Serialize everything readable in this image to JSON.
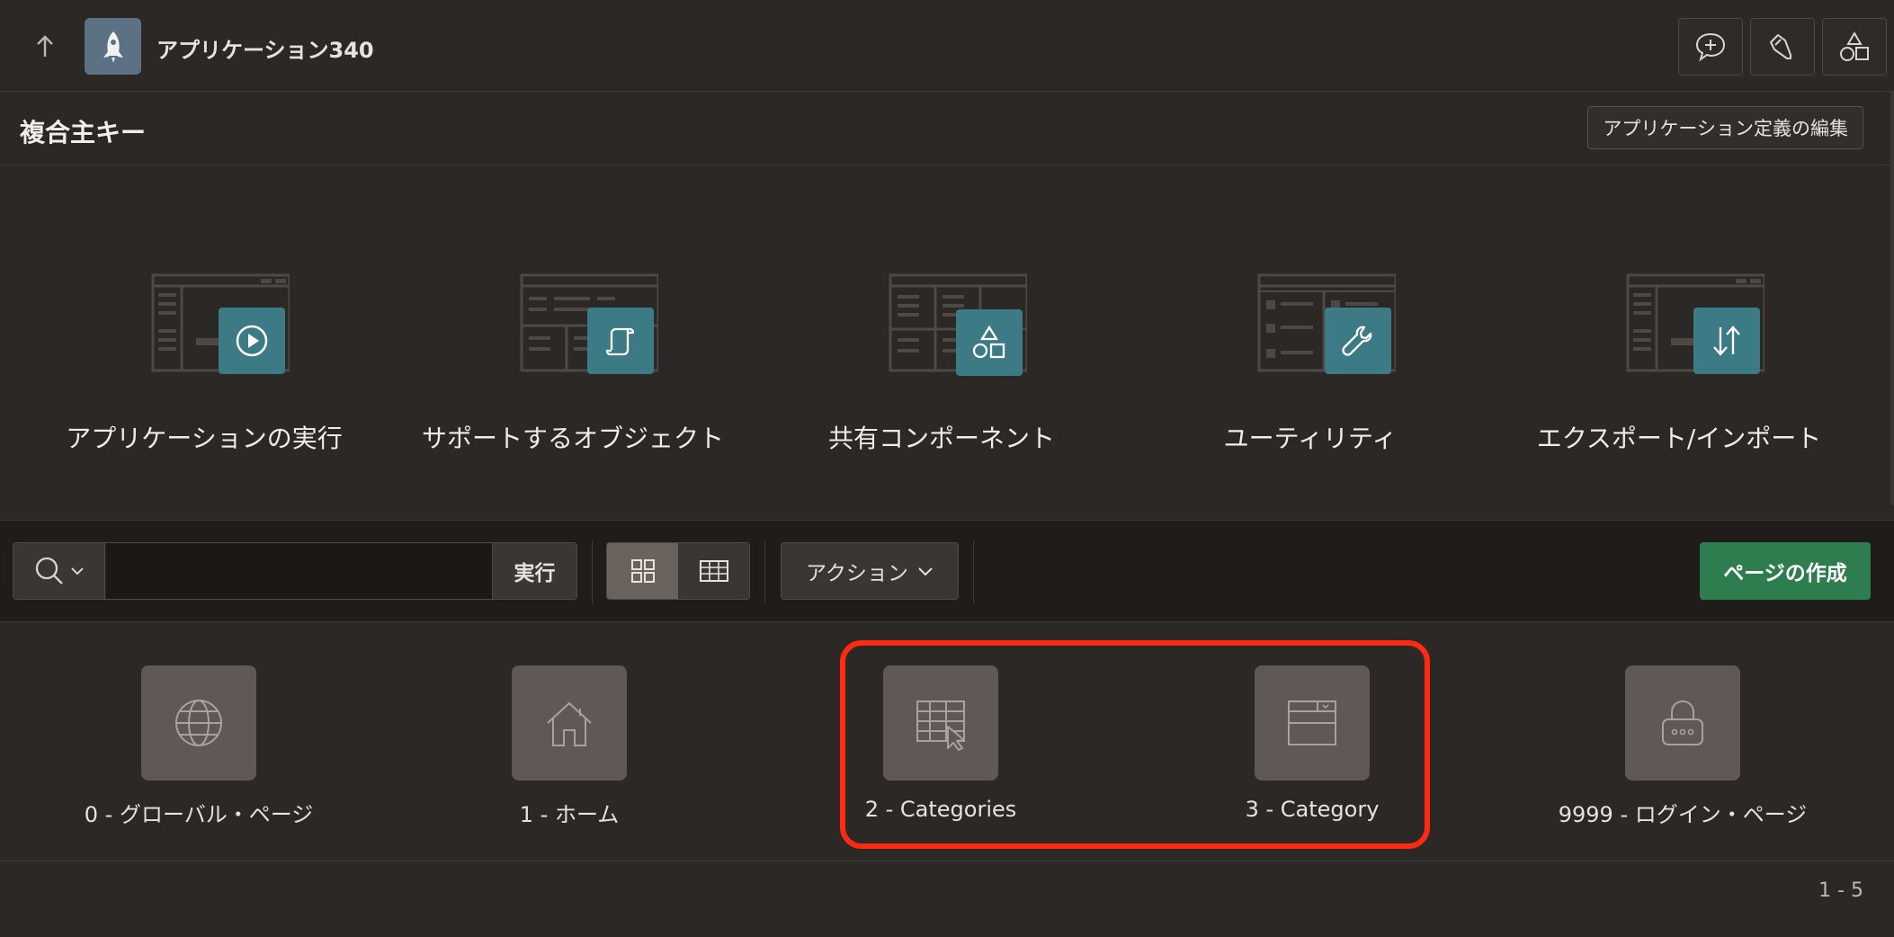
{
  "header": {
    "app_title": "アプリケーション340",
    "icons": [
      "arrow-up-icon",
      "rocket-icon",
      "feedback-icon",
      "flashlight-icon",
      "shapes-icon"
    ]
  },
  "region": {
    "title": "複合主キー",
    "edit_button": "アプリケーション定義の編集"
  },
  "tiles": [
    {
      "label": "アプリケーションの実行",
      "icon": "play-icon"
    },
    {
      "label": "サポートするオブジェクト",
      "icon": "scroll-icon"
    },
    {
      "label": "共有コンポーネント",
      "icon": "shapes-icon"
    },
    {
      "label": "ユーティリティ",
      "icon": "wrench-icon"
    },
    {
      "label": "エクスポート/インポート",
      "icon": "up-down-arrows-icon"
    }
  ],
  "toolbar": {
    "search_placeholder": "",
    "go_label": "実行",
    "actions_label": "アクション",
    "create_page_label": "ページの作成",
    "view_mode": "icons"
  },
  "pages": [
    {
      "label": "0 - グローバル・ページ",
      "icon": "globe-icon"
    },
    {
      "label": "1 - ホーム",
      "icon": "home-icon"
    },
    {
      "label": "2 - Categories",
      "icon": "interactive-grid-icon"
    },
    {
      "label": "3 - Category",
      "icon": "form-icon"
    },
    {
      "label": "9999 - ログイン・ページ",
      "icon": "lock-icon"
    }
  ],
  "pager": {
    "text": "1 - 5"
  },
  "colors": {
    "background": "#2c2825",
    "badge": "#3c7a86",
    "create_button": "#2e7d4f",
    "highlight": "#ff2a12"
  }
}
